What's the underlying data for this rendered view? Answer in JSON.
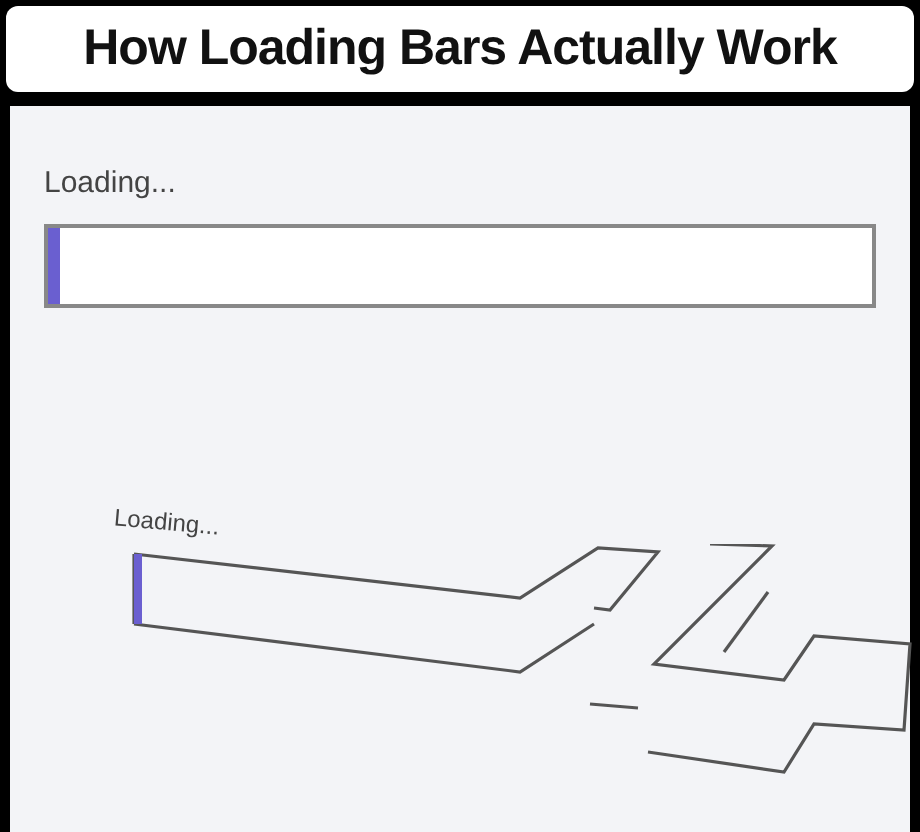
{
  "title": "How Loading Bars Actually Work",
  "loaders": [
    {
      "kind": "flat",
      "label": "Loading...",
      "level": 0.015
    },
    {
      "kind": "twisted",
      "label": "Loading...",
      "level": 0.015
    }
  ]
}
